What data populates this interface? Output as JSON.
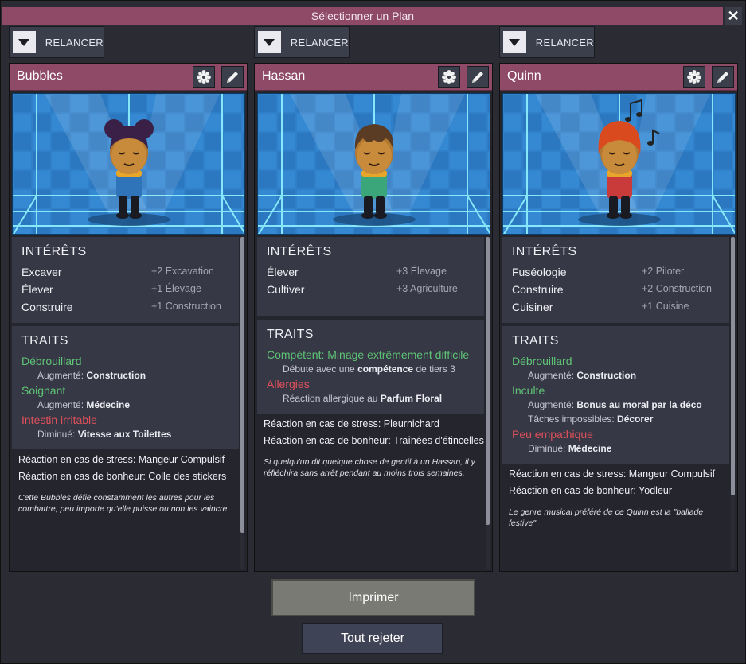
{
  "window": {
    "title": "Sélectionner un Plan",
    "close_icon": "close-icon"
  },
  "colors": {
    "accent": "#8e4a67",
    "positive": "#5fc475",
    "negative": "#e0505a"
  },
  "reroll_label": "RELANCER",
  "cards": [
    {
      "name": "Bubbles",
      "interests_title": "INTÉRÊTS",
      "interests": [
        {
          "name": "Excaver",
          "bonus": "+2 Excavation"
        },
        {
          "name": "Élever",
          "bonus": "+1 Élevage"
        },
        {
          "name": "Construire",
          "bonus": "+1 Construction"
        }
      ],
      "traits_title": "TRAITS",
      "traits": [
        {
          "name": "Débrouillard",
          "kind": "pos",
          "desc_prefix": "Augmenté: ",
          "desc_bold": "Construction",
          "desc_suffix": ""
        },
        {
          "name": "Soignant",
          "kind": "pos",
          "desc_prefix": "Augmenté: ",
          "desc_bold": "Médecine",
          "desc_suffix": ""
        },
        {
          "name": "Intestin irritable",
          "kind": "neg",
          "desc_prefix": "Diminué: ",
          "desc_bold": "Vitesse aux Toilettes",
          "desc_suffix": ""
        }
      ],
      "stress": "Réaction en cas de stress: Mangeur Compulsif",
      "joy": "Réaction en cas de bonheur: Colle des stickers",
      "bio": "Cette Bubbles défie constamment les autres pour les combattre, peu importe qu'elle puisse ou non les vaincre."
    },
    {
      "name": "Hassan",
      "interests_title": "INTÉRÊTS",
      "interests": [
        {
          "name": "Élever",
          "bonus": "+3 Élevage"
        },
        {
          "name": "Cultiver",
          "bonus": "+3 Agriculture"
        }
      ],
      "traits_title": "TRAITS",
      "traits": [
        {
          "name": "Compétent: Minage extrêmement difficile",
          "kind": "pos",
          "desc_prefix": "Débute avec une ",
          "desc_bold": "compétence",
          "desc_suffix": " de tiers 3"
        },
        {
          "name": "Allergies",
          "kind": "neg",
          "desc_prefix": "Réaction allergique au ",
          "desc_bold": "Parfum Floral",
          "desc_suffix": ""
        }
      ],
      "stress": "Réaction en cas de stress: Pleurnichard",
      "joy": "Réaction en cas de bonheur: Traînées d'étincelles",
      "bio": "Si quelqu'un dit quelque chose de gentil à un Hassan, il y réfléchira sans arrêt pendant au moins trois semaines."
    },
    {
      "name": "Quinn",
      "interests_title": "INTÉRÊTS",
      "interests": [
        {
          "name": "Fuséologie",
          "bonus": "+2 Piloter"
        },
        {
          "name": "Construire",
          "bonus": "+2 Construction"
        },
        {
          "name": "Cuisiner",
          "bonus": "+1 Cuisine"
        }
      ],
      "traits_title": "TRAITS",
      "traits": [
        {
          "name": "Débrouillard",
          "kind": "pos",
          "desc_prefix": "Augmenté: ",
          "desc_bold": "Construction",
          "desc_suffix": ""
        },
        {
          "name": "Inculte",
          "kind": "pos",
          "desc_prefix": "Augmenté: ",
          "desc_bold": "Bonus au moral par la déco",
          "desc_suffix": "",
          "desc2_prefix": "Tâches impossibles: ",
          "desc2_bold": "Décorer"
        },
        {
          "name": "Peu empathique",
          "kind": "neg",
          "desc_prefix": "Diminué: ",
          "desc_bold": "Médecine",
          "desc_suffix": ""
        }
      ],
      "stress": "Réaction en cas de stress: Mangeur Compulsif",
      "joy": "Réaction en cas de bonheur: Yodleur",
      "bio": "Le genre musical préféré de ce Quinn est la \"ballade festive\""
    }
  ],
  "buttons": {
    "print": "Imprimer",
    "reject_all": "Tout rejeter"
  }
}
